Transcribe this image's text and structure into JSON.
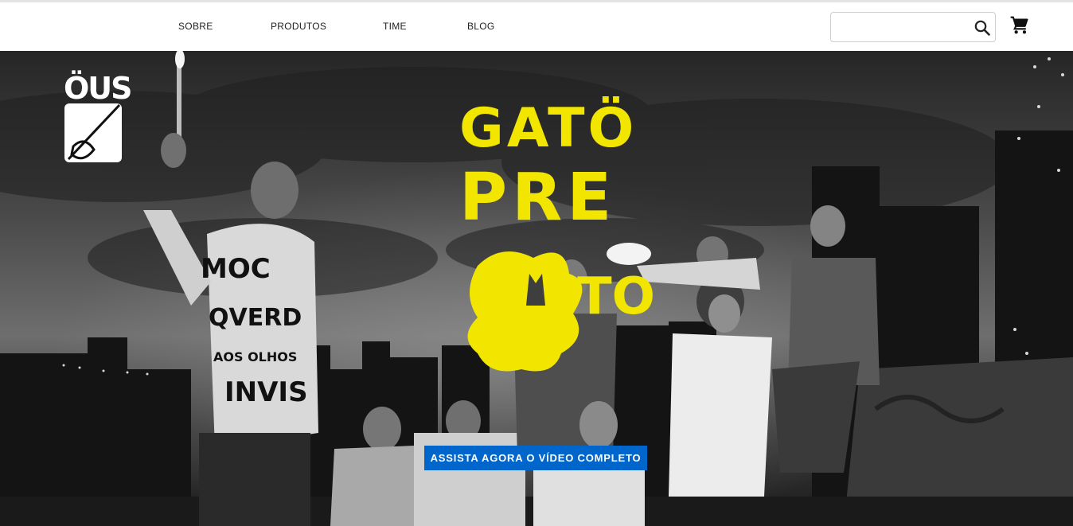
{
  "nav": {
    "items": [
      {
        "label": "SOBRE"
      },
      {
        "label": "PRODUTOS"
      },
      {
        "label": "TIME"
      },
      {
        "label": "BLOG"
      }
    ]
  },
  "search": {
    "value": "",
    "icon": "search-icon"
  },
  "cart": {
    "icon": "shopping-cart-icon"
  },
  "brand": {
    "logo_text": "ÖUS"
  },
  "hero": {
    "title_line1": "GATÖ",
    "title_line2": "PRE",
    "title_line3": "TO",
    "title_color": "#f2e600",
    "cta_label": "ASSISTA AGORA O VÍDEO COMPLETO",
    "cta_color": "#0066cc",
    "jacket_text_1": "MOC",
    "jacket_text_2": "QVERD",
    "jacket_text_3": "AOS OLHOS",
    "jacket_text_4": "INVIS"
  }
}
